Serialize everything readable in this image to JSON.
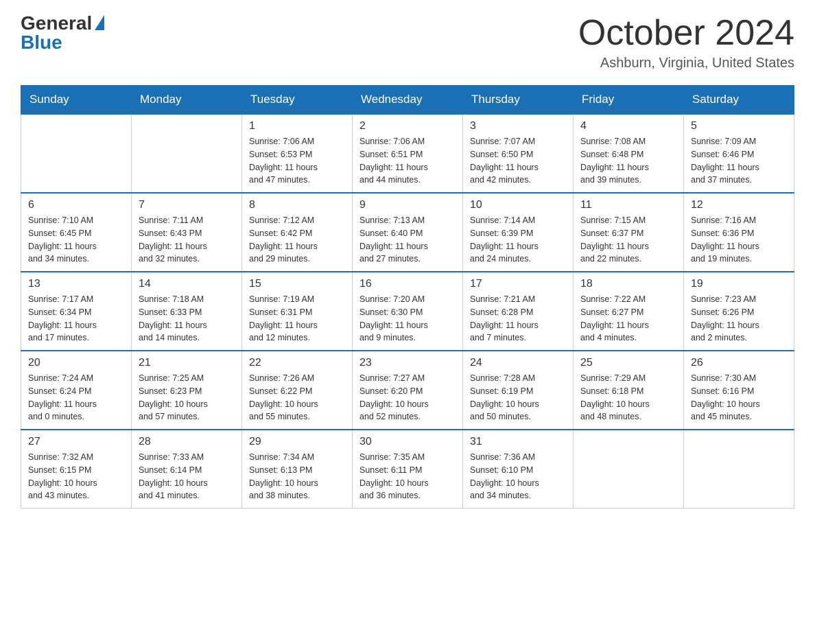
{
  "logo": {
    "general": "General",
    "blue": "Blue"
  },
  "title": "October 2024",
  "location": "Ashburn, Virginia, United States",
  "days_of_week": [
    "Sunday",
    "Monday",
    "Tuesday",
    "Wednesday",
    "Thursday",
    "Friday",
    "Saturday"
  ],
  "weeks": [
    [
      {
        "day": "",
        "info": ""
      },
      {
        "day": "",
        "info": ""
      },
      {
        "day": "1",
        "info": "Sunrise: 7:06 AM\nSunset: 6:53 PM\nDaylight: 11 hours\nand 47 minutes."
      },
      {
        "day": "2",
        "info": "Sunrise: 7:06 AM\nSunset: 6:51 PM\nDaylight: 11 hours\nand 44 minutes."
      },
      {
        "day": "3",
        "info": "Sunrise: 7:07 AM\nSunset: 6:50 PM\nDaylight: 11 hours\nand 42 minutes."
      },
      {
        "day": "4",
        "info": "Sunrise: 7:08 AM\nSunset: 6:48 PM\nDaylight: 11 hours\nand 39 minutes."
      },
      {
        "day": "5",
        "info": "Sunrise: 7:09 AM\nSunset: 6:46 PM\nDaylight: 11 hours\nand 37 minutes."
      }
    ],
    [
      {
        "day": "6",
        "info": "Sunrise: 7:10 AM\nSunset: 6:45 PM\nDaylight: 11 hours\nand 34 minutes."
      },
      {
        "day": "7",
        "info": "Sunrise: 7:11 AM\nSunset: 6:43 PM\nDaylight: 11 hours\nand 32 minutes."
      },
      {
        "day": "8",
        "info": "Sunrise: 7:12 AM\nSunset: 6:42 PM\nDaylight: 11 hours\nand 29 minutes."
      },
      {
        "day": "9",
        "info": "Sunrise: 7:13 AM\nSunset: 6:40 PM\nDaylight: 11 hours\nand 27 minutes."
      },
      {
        "day": "10",
        "info": "Sunrise: 7:14 AM\nSunset: 6:39 PM\nDaylight: 11 hours\nand 24 minutes."
      },
      {
        "day": "11",
        "info": "Sunrise: 7:15 AM\nSunset: 6:37 PM\nDaylight: 11 hours\nand 22 minutes."
      },
      {
        "day": "12",
        "info": "Sunrise: 7:16 AM\nSunset: 6:36 PM\nDaylight: 11 hours\nand 19 minutes."
      }
    ],
    [
      {
        "day": "13",
        "info": "Sunrise: 7:17 AM\nSunset: 6:34 PM\nDaylight: 11 hours\nand 17 minutes."
      },
      {
        "day": "14",
        "info": "Sunrise: 7:18 AM\nSunset: 6:33 PM\nDaylight: 11 hours\nand 14 minutes."
      },
      {
        "day": "15",
        "info": "Sunrise: 7:19 AM\nSunset: 6:31 PM\nDaylight: 11 hours\nand 12 minutes."
      },
      {
        "day": "16",
        "info": "Sunrise: 7:20 AM\nSunset: 6:30 PM\nDaylight: 11 hours\nand 9 minutes."
      },
      {
        "day": "17",
        "info": "Sunrise: 7:21 AM\nSunset: 6:28 PM\nDaylight: 11 hours\nand 7 minutes."
      },
      {
        "day": "18",
        "info": "Sunrise: 7:22 AM\nSunset: 6:27 PM\nDaylight: 11 hours\nand 4 minutes."
      },
      {
        "day": "19",
        "info": "Sunrise: 7:23 AM\nSunset: 6:26 PM\nDaylight: 11 hours\nand 2 minutes."
      }
    ],
    [
      {
        "day": "20",
        "info": "Sunrise: 7:24 AM\nSunset: 6:24 PM\nDaylight: 11 hours\nand 0 minutes."
      },
      {
        "day": "21",
        "info": "Sunrise: 7:25 AM\nSunset: 6:23 PM\nDaylight: 10 hours\nand 57 minutes."
      },
      {
        "day": "22",
        "info": "Sunrise: 7:26 AM\nSunset: 6:22 PM\nDaylight: 10 hours\nand 55 minutes."
      },
      {
        "day": "23",
        "info": "Sunrise: 7:27 AM\nSunset: 6:20 PM\nDaylight: 10 hours\nand 52 minutes."
      },
      {
        "day": "24",
        "info": "Sunrise: 7:28 AM\nSunset: 6:19 PM\nDaylight: 10 hours\nand 50 minutes."
      },
      {
        "day": "25",
        "info": "Sunrise: 7:29 AM\nSunset: 6:18 PM\nDaylight: 10 hours\nand 48 minutes."
      },
      {
        "day": "26",
        "info": "Sunrise: 7:30 AM\nSunset: 6:16 PM\nDaylight: 10 hours\nand 45 minutes."
      }
    ],
    [
      {
        "day": "27",
        "info": "Sunrise: 7:32 AM\nSunset: 6:15 PM\nDaylight: 10 hours\nand 43 minutes."
      },
      {
        "day": "28",
        "info": "Sunrise: 7:33 AM\nSunset: 6:14 PM\nDaylight: 10 hours\nand 41 minutes."
      },
      {
        "day": "29",
        "info": "Sunrise: 7:34 AM\nSunset: 6:13 PM\nDaylight: 10 hours\nand 38 minutes."
      },
      {
        "day": "30",
        "info": "Sunrise: 7:35 AM\nSunset: 6:11 PM\nDaylight: 10 hours\nand 36 minutes."
      },
      {
        "day": "31",
        "info": "Sunrise: 7:36 AM\nSunset: 6:10 PM\nDaylight: 10 hours\nand 34 minutes."
      },
      {
        "day": "",
        "info": ""
      },
      {
        "day": "",
        "info": ""
      }
    ]
  ]
}
